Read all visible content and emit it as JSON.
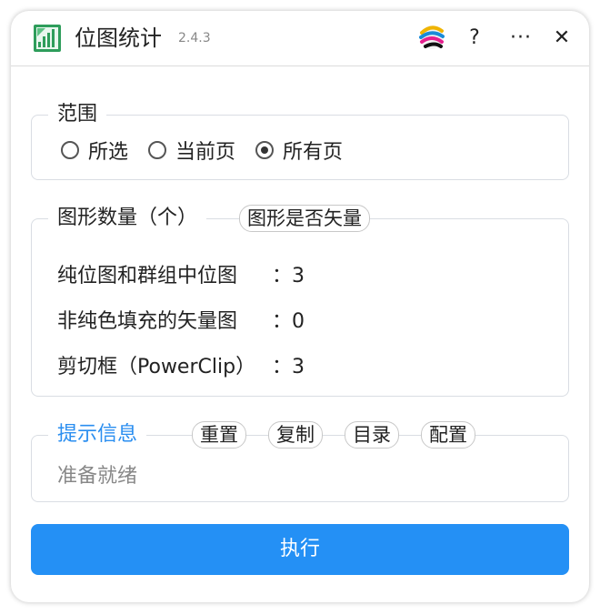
{
  "window": {
    "title": "位图统计",
    "version": "2.4.3",
    "help_label": "?",
    "more_label": "···",
    "close_label": "✕",
    "icons": {
      "app": "bitmap-stats-icon",
      "brand": "brand-logo-icon"
    }
  },
  "scope": {
    "legend": "范围",
    "options": [
      {
        "label": "所选",
        "checked": false
      },
      {
        "label": "当前页",
        "checked": false
      },
      {
        "label": "所有页",
        "checked": true
      }
    ]
  },
  "counts": {
    "legend": "图形数量（个）",
    "vector_check_button": "图形是否矢量",
    "rows": [
      {
        "name": "纯位图和群组中位图",
        "colon": "：",
        "value": "3"
      },
      {
        "name": "非纯色填充的矢量图",
        "colon": "：",
        "value": "0"
      },
      {
        "name": "剪切框（PowerClip）",
        "colon": "：",
        "value": "3"
      }
    ]
  },
  "info": {
    "legend": "提示信息",
    "buttons": [
      "重置",
      "复制",
      "目录",
      "配置"
    ],
    "status": "准备就绪"
  },
  "run_button": "执行",
  "colors": {
    "accent": "#2490f5",
    "legend_blue": "#2a8ef0",
    "border": "#d9dde3"
  }
}
